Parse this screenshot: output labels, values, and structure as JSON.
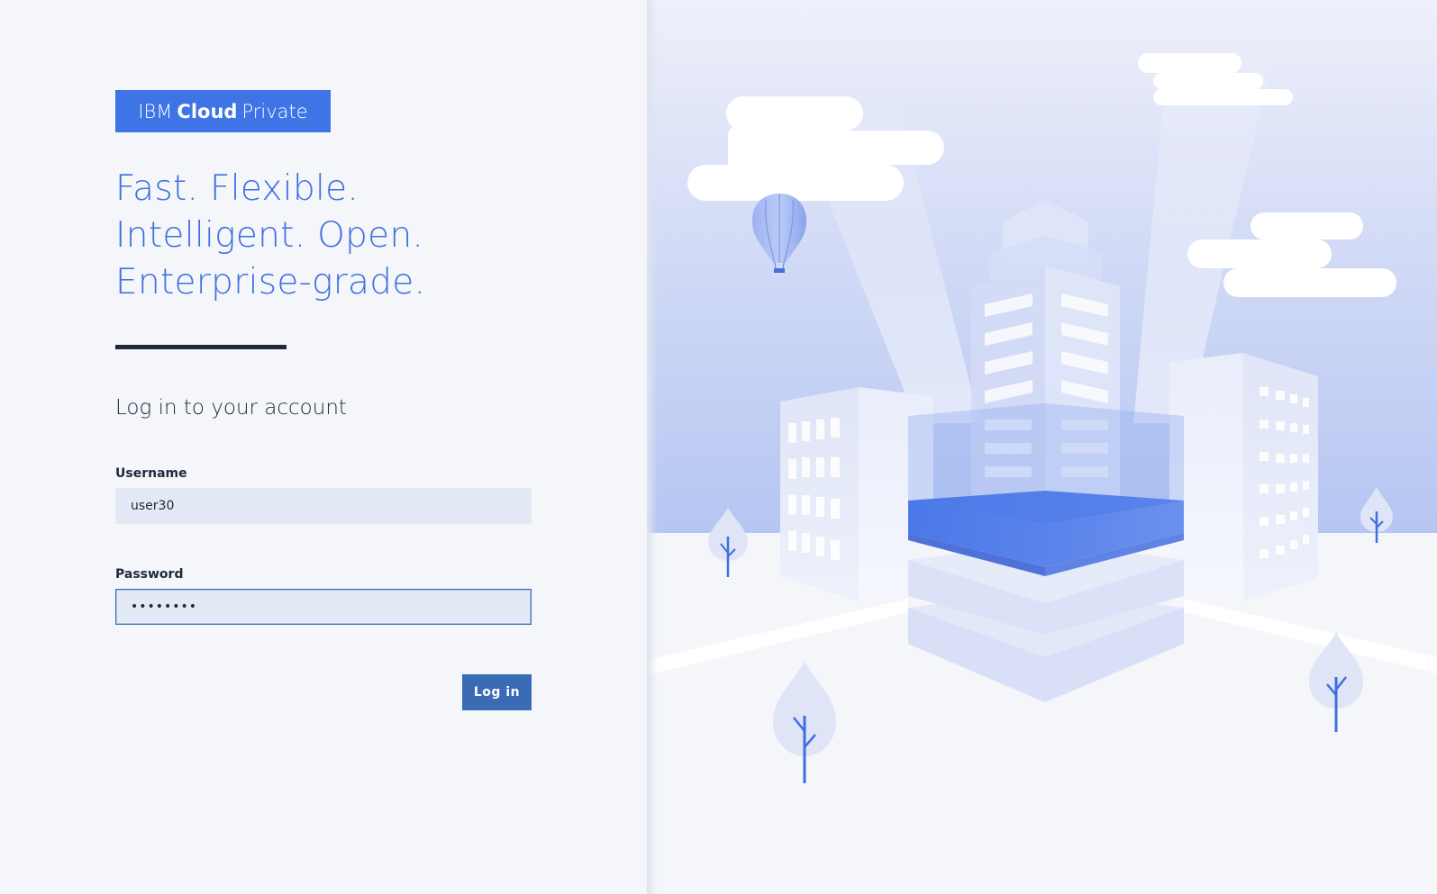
{
  "brand": {
    "prefix": "IBM",
    "bold": "Cloud",
    "suffix": "Private",
    "color": "#3f74e6"
  },
  "tagline": {
    "line1": "Fast. Flexible.",
    "line2": "Intelligent. Open.",
    "line3": "Enterprise-grade."
  },
  "login": {
    "heading": "Log in to your account",
    "username_label": "Username",
    "username_value": "user30",
    "password_label": "Password",
    "password_value": "••••••••",
    "submit_label": "Log in"
  },
  "colors": {
    "accent": "#3f6fe0",
    "button": "#3a6bb5",
    "input_bg": "#e4eaf5",
    "dark_text": "#1f2a3a"
  },
  "illustration": {
    "icons": [
      "cloud-icon",
      "hot-air-balloon-icon",
      "building-icon",
      "tree-icon"
    ]
  }
}
